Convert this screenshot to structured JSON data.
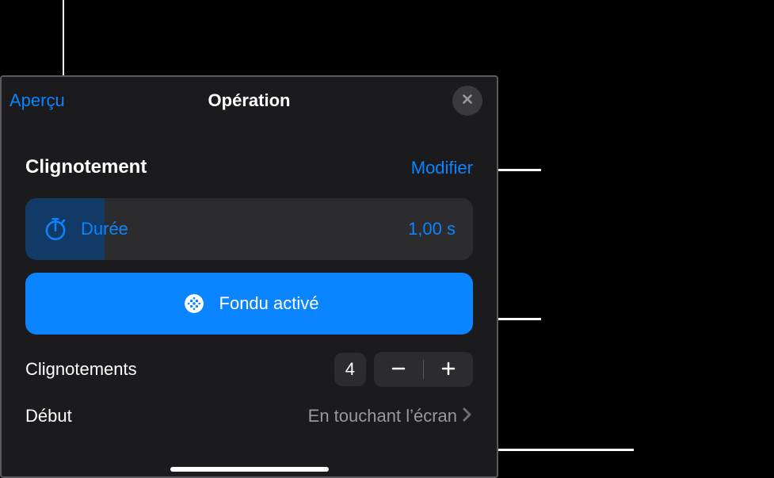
{
  "header": {
    "preview_label": "Aperçu",
    "title": "Opération"
  },
  "section": {
    "title": "Clignotement",
    "modify_label": "Modifier"
  },
  "duration": {
    "label": "Durée",
    "value": "1,00 s"
  },
  "fade": {
    "label": "Fondu activé"
  },
  "stepper": {
    "label": "Clignotements",
    "value": "4"
  },
  "start": {
    "label": "Début",
    "value": "En touchant l’écran"
  },
  "colors": {
    "accent": "#0b84ff"
  }
}
